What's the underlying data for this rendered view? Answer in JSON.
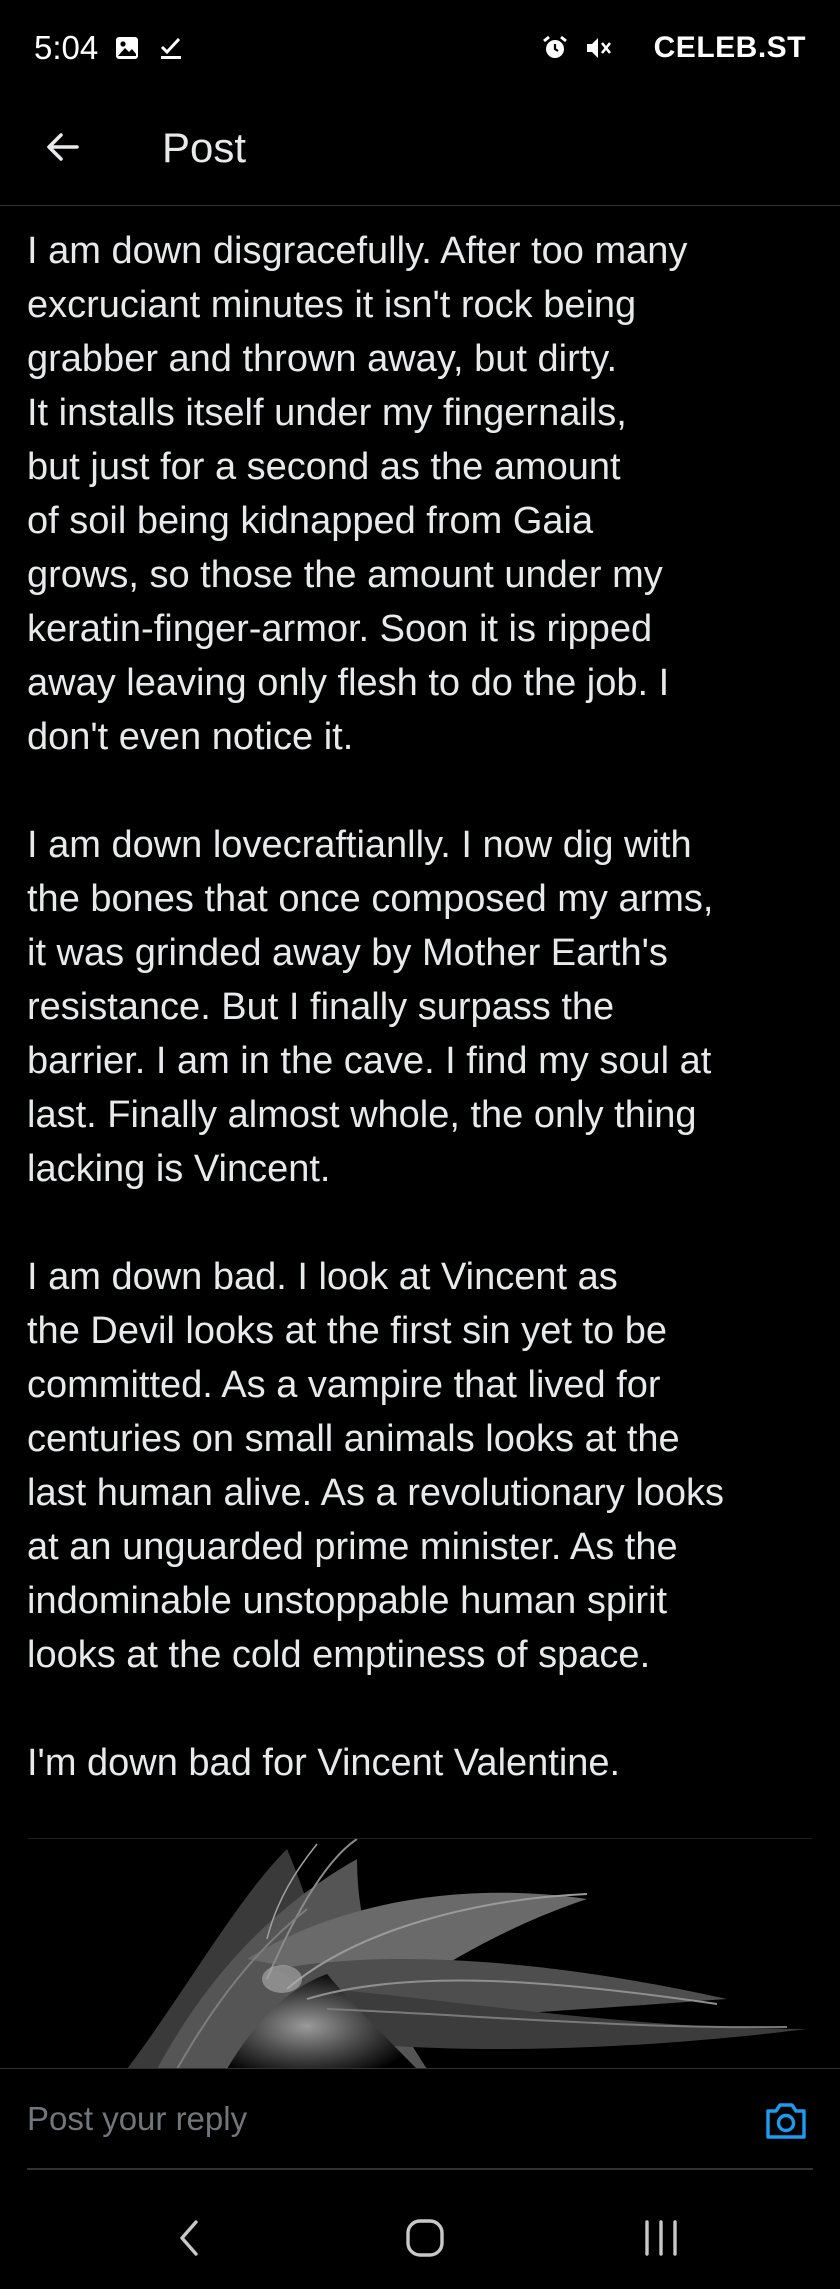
{
  "status_bar": {
    "time": "5:04",
    "brand": "CELEB.ST",
    "icons": [
      "image-icon",
      "check-icon",
      "alarm-icon",
      "mute-icon"
    ]
  },
  "header": {
    "title": "Post",
    "back_icon": "arrow-left-icon"
  },
  "post": {
    "paragraphs": [
      "I am down disgracefully. After too many\nexcruciant minutes it isn't rock being\ngrabber and thrown away, but dirty.\nIt installs itself under my fingernails,\nbut just for a second as the amount\nof soil being kidnapped from Gaia\ngrows, so those the amount under my\nkeratin-finger-armor. Soon it is ripped\naway leaving only flesh to do the job. I\ndon't even notice it.",
      "I am down lovecraftianlly. I now dig with\nthe bones that once composed my arms,\nit was grinded away by Mother Earth's\nresistance. But I finally surpass the\nbarrier. I am in the cave. I find my soul at\nlast. Finally almost whole, the only thing\nlacking is Vincent.",
      "I am down bad. I look at Vincent as\nthe Devil looks at the first sin yet to be\ncommitted. As a vampire that lived for\ncenturies on small animals looks at the\nlast human alive. As a revolutionary looks\nat an unguarded prime minister. As the\nindominable unstoppable human spirit\nlooks at the cold emptiness of space.",
      "I'm down bad for Vincent Valentine."
    ]
  },
  "reply": {
    "placeholder": "Post your reply",
    "camera_icon": "camera-icon"
  },
  "nav": {
    "back_icon": "nav-back-icon",
    "home_icon": "nav-home-icon",
    "recents_icon": "nav-recents-icon"
  },
  "colors": {
    "background": "#000000",
    "text": "#e7e9ea",
    "muted": "#71767b",
    "accent": "#1d9bf0",
    "divider": "#2f3336"
  }
}
